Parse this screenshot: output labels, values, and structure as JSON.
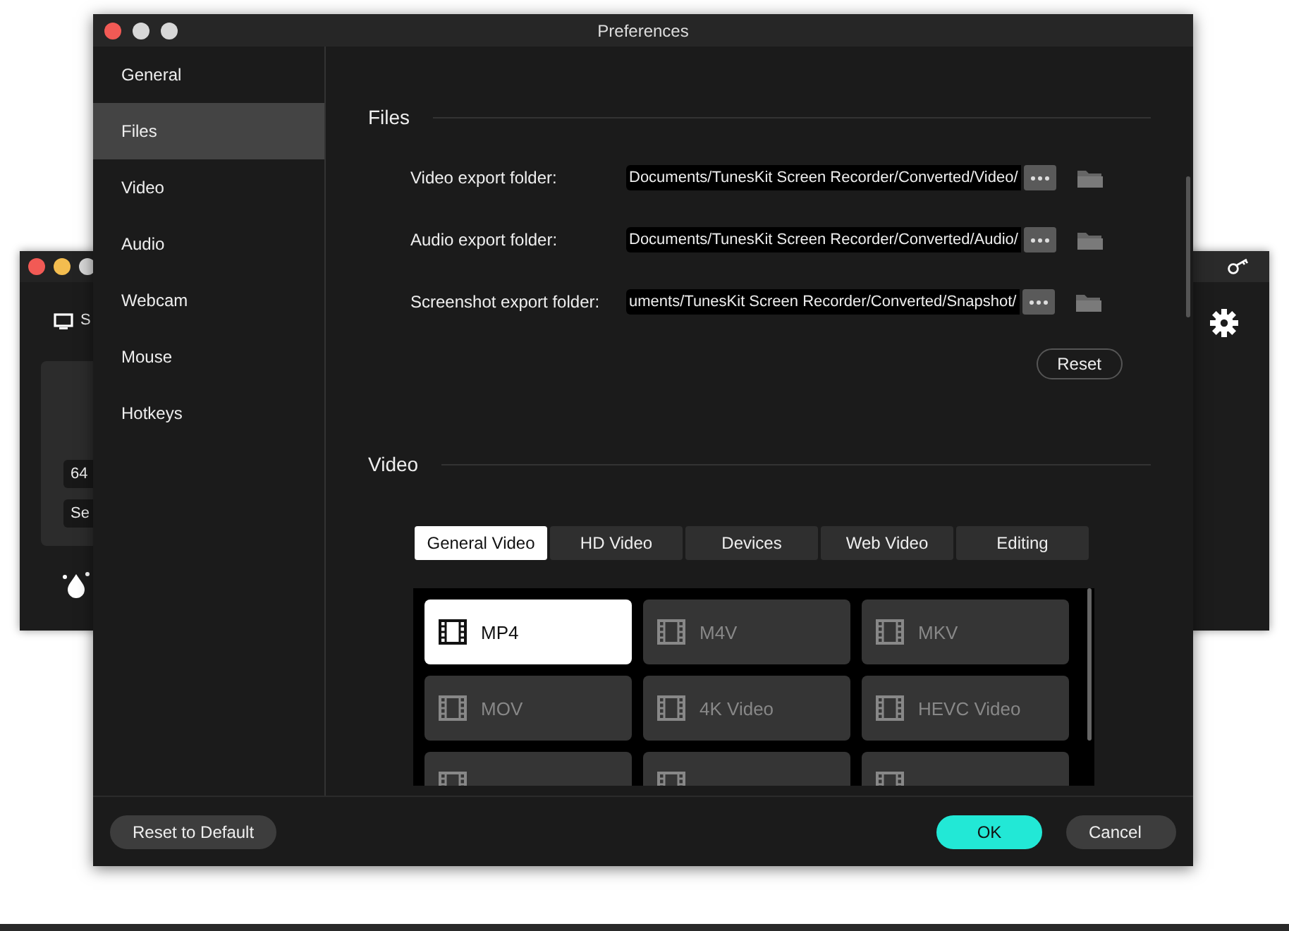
{
  "back_window": {
    "source_label": "S",
    "fields": [
      "64",
      "Se"
    ]
  },
  "window": {
    "title": "Preferences"
  },
  "sidebar": {
    "items": [
      {
        "label": "General",
        "selected": false
      },
      {
        "label": "Files",
        "selected": true
      },
      {
        "label": "Video",
        "selected": false
      },
      {
        "label": "Audio",
        "selected": false
      },
      {
        "label": "Webcam",
        "selected": false
      },
      {
        "label": "Mouse",
        "selected": false
      },
      {
        "label": "Hotkeys",
        "selected": false
      }
    ]
  },
  "files": {
    "heading": "Files",
    "folders": [
      {
        "label": "Video export folder:",
        "value": "Documents/TunesKit Screen Recorder/Converted/Video/"
      },
      {
        "label": "Audio export folder:",
        "value": "Documents/TunesKit Screen Recorder/Converted/Audio/"
      },
      {
        "label": "Screenshot export folder:",
        "value": "uments/TunesKit Screen Recorder/Converted/Snapshot/"
      }
    ],
    "reset": "Reset"
  },
  "video": {
    "heading": "Video",
    "tabs": [
      {
        "label": "General Video",
        "selected": true
      },
      {
        "label": "HD Video",
        "selected": false
      },
      {
        "label": "Devices",
        "selected": false
      },
      {
        "label": "Web Video",
        "selected": false
      },
      {
        "label": "Editing",
        "selected": false
      }
    ],
    "formats": [
      {
        "label": "MP4",
        "selected": true
      },
      {
        "label": "M4V",
        "selected": false
      },
      {
        "label": "MKV",
        "selected": false
      },
      {
        "label": "MOV",
        "selected": false
      },
      {
        "label": "4K Video",
        "selected": false
      },
      {
        "label": "HEVC Video",
        "selected": false
      }
    ]
  },
  "footer": {
    "reset_default": "Reset to Default",
    "ok": "OK",
    "cancel": "Cancel"
  }
}
